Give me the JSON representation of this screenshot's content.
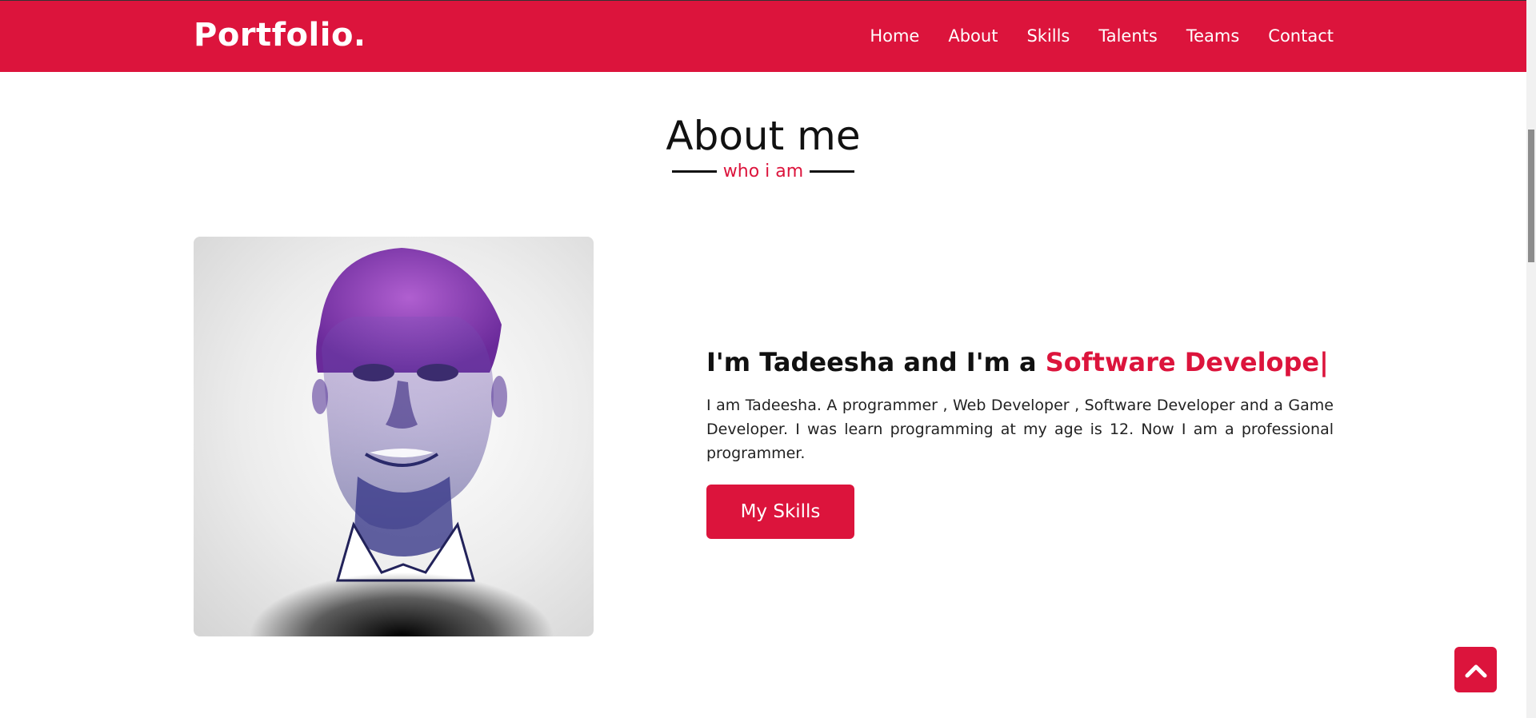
{
  "brand": "Portfolio.",
  "nav": [
    "Home",
    "About",
    "Skills",
    "Talents",
    "Teams",
    "Contact"
  ],
  "section": {
    "title": "About me",
    "subtitle": "who i am"
  },
  "intro": {
    "prefix": "I'm Tadeesha and I'm a ",
    "typed": "Software Develope|",
    "paragraph": "I am Tadeesha. A programmer , Web Developer , Software Developer and a Game Developer. I was learn programming at my age is 12. Now I am a professional programmer.",
    "button": "My Skills"
  },
  "icons": {
    "to_top": "chevron-up-icon"
  },
  "colors": {
    "accent": "#dc143c",
    "text": "#111111"
  }
}
